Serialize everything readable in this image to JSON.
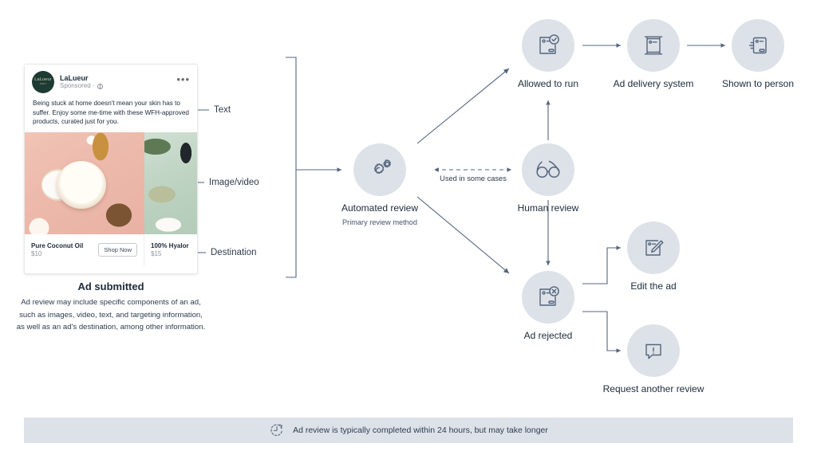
{
  "ad": {
    "brand": "LaLueur",
    "avatar_text": "LaLueur",
    "avatar_sub": "PARIS",
    "sponsored": "Sponsored ·",
    "menu": "•••",
    "body": "Being stuck at home doesn't mean your skin has to suffer. Enjoy some me-time with these WFH-approved products, curated just for you.",
    "products": [
      {
        "name": "Pure Coconut Oil",
        "price": "$10",
        "cta": "Shop Now"
      },
      {
        "name": "100% Hyalor",
        "price": "$15"
      }
    ]
  },
  "callouts": [
    {
      "label": "Text"
    },
    {
      "label": "Image/video"
    },
    {
      "label": "Destination"
    }
  ],
  "caption": {
    "title": "Ad submitted",
    "body": "Ad review may include specific components of an ad, such as images, video, text, and targeting information, as well as an ad's destination, among other information."
  },
  "nodes": {
    "automated_review": {
      "title": "Automated review",
      "subtitle": "Primary review method",
      "icon": "gears-icon"
    },
    "human_review": {
      "title": "Human review",
      "icon": "glasses-icon"
    },
    "allowed_to_run": {
      "title": "Allowed to run",
      "icon": "ad-approved-icon"
    },
    "ad_delivery_system": {
      "title": "Ad delivery system",
      "icon": "server-icon"
    },
    "shown_to_person": {
      "title": "Shown to person",
      "icon": "ad-shown-icon"
    },
    "ad_rejected": {
      "title": "Ad rejected",
      "icon": "ad-rejected-icon"
    },
    "edit_the_ad": {
      "title": "Edit the ad",
      "icon": "ad-edit-icon"
    },
    "request_another_review": {
      "title": "Request another review",
      "icon": "speech-bubble-alert-icon"
    }
  },
  "connectors": {
    "dashed_label": "Used in some cases"
  },
  "footer": {
    "icon": "clock-refresh-icon",
    "text": "Ad review is typically completed within 24 hours, but may take longer"
  },
  "colors": {
    "node_circle": "#dde2e9",
    "stroke": "#55657c",
    "text": "#2d3b4e",
    "footer_bg": "#dde2e9",
    "avatar_bg": "#1d3b32"
  }
}
